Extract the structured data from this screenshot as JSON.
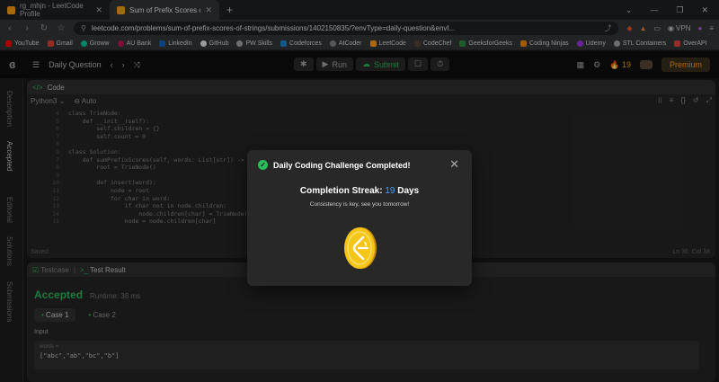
{
  "browser": {
    "tabs": [
      {
        "title": "rg_mhjn - LeetCode Profile",
        "active": false
      },
      {
        "title": "Sum of Prefix Scores of Strings",
        "active": true
      }
    ],
    "url": "leetcode.com/problems/sum-of-prefix-scores-of-strings/submissions/1402150835/?envType=daily-question&envI...",
    "vpn_label": "VPN",
    "bookmarks": [
      "YouTube",
      "Gmail",
      "Groww",
      "AU Bank",
      "LinkedIn",
      "GitHub",
      "PW Skills",
      "Codeforces",
      "AtCoder",
      "LeetCode",
      "CodeChef",
      "GeeksforGeeks",
      "Coding Ninjas",
      "Udemy",
      "STL Containers",
      "OverAPI"
    ]
  },
  "leetcode": {
    "daily_question": "Daily Question",
    "run_label": "Run",
    "submit_label": "Submit",
    "streak_count": "19",
    "premium_label": "Premium",
    "side_tabs": [
      "Description",
      "Accepted",
      "Editorial",
      "Solutions",
      "Submissions"
    ],
    "code_panel_title": "Code",
    "language": "Python3",
    "auto_label": "Auto",
    "saved_label": "Saved",
    "cursor_pos": "Ln 36, Col 38",
    "code_lines": [
      {
        "n": "4",
        "text": "class TrieNode:"
      },
      {
        "n": "5",
        "text": "    def __init__(self):"
      },
      {
        "n": "6",
        "text": "        self.children = {}"
      },
      {
        "n": "7",
        "text": "        self.count = 0"
      },
      {
        "n": "8",
        "text": ""
      },
      {
        "n": "9",
        "text": "class Solution:"
      },
      {
        "n": "7",
        "text": "    def sumPrefixScores(self, words: List[str]) -> List[int]:"
      },
      {
        "n": "8",
        "text": "        root = TrieNode()"
      },
      {
        "n": "9",
        "text": ""
      },
      {
        "n": "10",
        "text": "        def insert(word):"
      },
      {
        "n": "11",
        "text": "            node = root"
      },
      {
        "n": "12",
        "text": "            for char in word:"
      },
      {
        "n": "13",
        "text": "                if char not in node.children:"
      },
      {
        "n": "14",
        "text": "                    node.children[char] = TrieNode()"
      },
      {
        "n": "15",
        "text": "                node = node.children[char]"
      }
    ],
    "testcase_tab": "Testcase",
    "result_tab": "Test Result",
    "accepted_label": "Accepted",
    "runtime_label": "Runtime: 38 ms",
    "case1": "Case 1",
    "case2": "Case 2",
    "input_label": "Input",
    "var_name": "words =",
    "var_value": "[\"abc\",\"ab\",\"bc\",\"b\"]"
  },
  "modal": {
    "title": "Daily Coding Challenge Completed!",
    "streak_prefix": "Completion Streak:",
    "streak_value": "19",
    "streak_suffix": "Days",
    "subtitle": "Consistency is key, see you tomorrow!"
  },
  "colors": {
    "accent_green": "#2cbb5d",
    "streak_blue": "#3e9ef5",
    "leetcode_orange": "#ffa116",
    "coin_gold": "#f5c518"
  }
}
